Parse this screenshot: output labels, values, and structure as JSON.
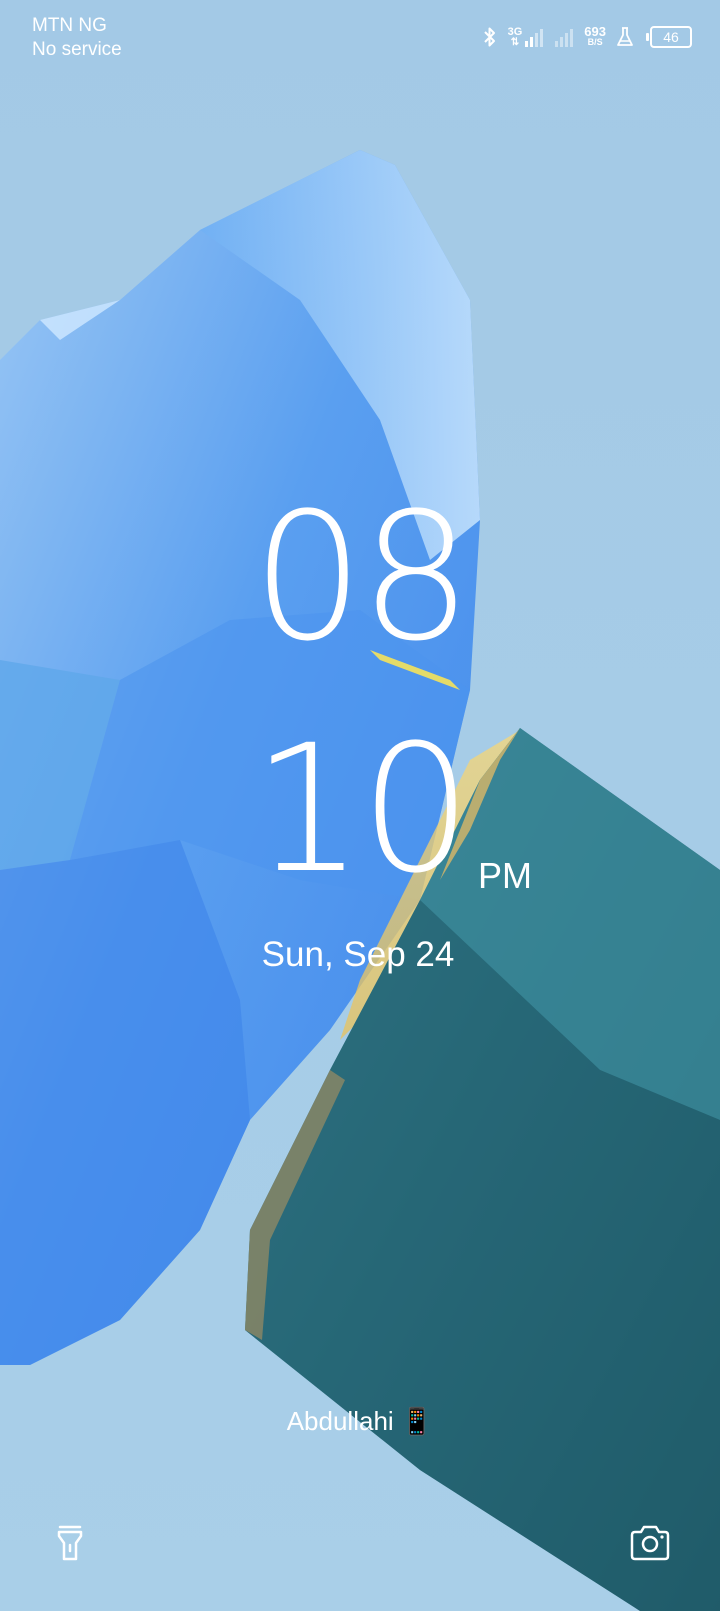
{
  "status_bar": {
    "carrier": "MTN NG",
    "service_status": "No service",
    "network_type": "3G",
    "network_speed_value": "693",
    "network_speed_unit": "B/S",
    "battery_level": "46",
    "icons": [
      "bluetooth-icon",
      "signal-3g-icon",
      "signal-empty-icon",
      "lab-flask-icon",
      "battery-icon"
    ]
  },
  "lock_screen": {
    "hour": "08",
    "minute": "10",
    "ampm": "PM",
    "date": "Sun, Sep 24",
    "owner_info": "Abdullahi 📱"
  },
  "shortcuts": {
    "left": "flashlight-icon",
    "right": "camera-icon"
  }
}
